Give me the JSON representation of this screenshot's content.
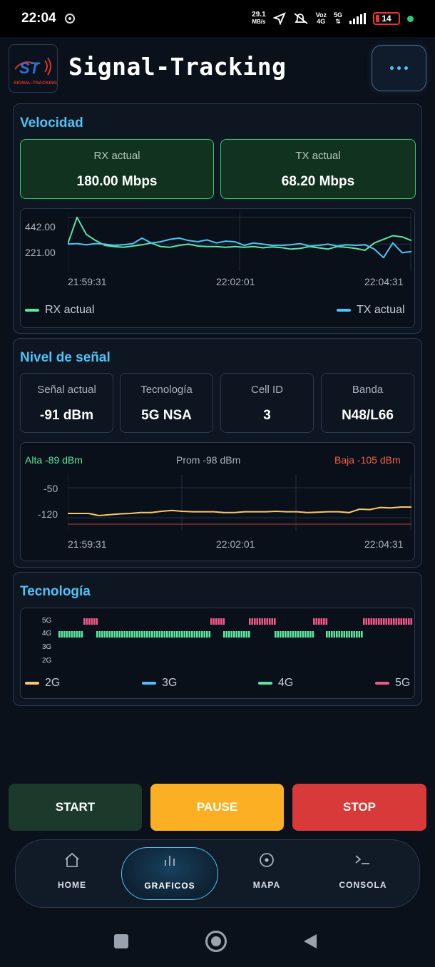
{
  "status_bar": {
    "time": "22:04",
    "net_speed": "29.1",
    "net_unit": "MB/s",
    "volte_top": "Voz",
    "volte_bottom": "4G",
    "network": "5G",
    "battery": "14"
  },
  "header": {
    "title": "Signal-Tracking",
    "logo_text": "ST",
    "logo_caption": "SIGNAL-TRACKING",
    "menu_icon": "more-dots-icon"
  },
  "velocidad": {
    "title": "Velocidad",
    "rx_label": "RX actual",
    "rx_value": "180.00 Mbps",
    "tx_label": "TX actual",
    "tx_value": "68.20 Mbps",
    "chart": {
      "y_ticks": [
        "442.00",
        "221.00"
      ],
      "x_ticks": [
        "21:59:31",
        "22:02:01",
        "22:04:31"
      ],
      "legend_rx": "RX actual",
      "legend_tx": "TX actual",
      "rx_color": "#59e8a0",
      "tx_color": "#4fc3f7"
    }
  },
  "nivel": {
    "title": "Nivel de señal",
    "cards": [
      {
        "label": "Señal actual",
        "value": "-91 dBm"
      },
      {
        "label": "Tecnología",
        "value": "5G NSA"
      },
      {
        "label": "Cell ID",
        "value": "3"
      },
      {
        "label": "Banda",
        "value": "N48/L66"
      }
    ],
    "chart": {
      "alta": "Alta -89 dBm",
      "prom": "Prom -98 dBm",
      "baja": "Baja -105 dBm",
      "y_ticks": [
        "-50",
        "-120"
      ],
      "x_ticks": [
        "21:59:31",
        "22:02:01",
        "22:04:31"
      ],
      "line_color": "#f7c86a"
    }
  },
  "tecnologia": {
    "title": "Tecnología",
    "rows": [
      "5G",
      "4G",
      "3G",
      "2G"
    ],
    "legend": [
      {
        "label": "2G",
        "color": "#f7c86a"
      },
      {
        "label": "3G",
        "color": "#4fc3f7"
      },
      {
        "label": "4G",
        "color": "#59e8a0"
      },
      {
        "label": "5G",
        "color": "#f0588a"
      }
    ]
  },
  "controls": {
    "start": "START",
    "pause": "PAUSE",
    "stop": "STOP"
  },
  "nav": {
    "home": "HOME",
    "graficos": "GRAFICOS",
    "mapa": "MAPA",
    "consola": "CONSOLA"
  },
  "chart_data": [
    {
      "type": "line",
      "x_ticks": [
        "21:59:31",
        "22:02:01",
        "22:04:31"
      ],
      "y_ticks": [
        442.0,
        221.0
      ],
      "ylim": [
        0,
        480
      ],
      "series": [
        {
          "name": "RX actual",
          "values": [
            221,
            440,
            300,
            250,
            210,
            200,
            195,
            205,
            215,
            230,
            200,
            195,
            210,
            220,
            205,
            200,
            200,
            195,
            200,
            195,
            200,
            190,
            198,
            192,
            180,
            185,
            200,
            190,
            180,
            200,
            195,
            185,
            170,
            230,
            260,
            290,
            280,
            250
          ]
        },
        {
          "name": "TX actual",
          "values": [
            221,
            225,
            215,
            225,
            220,
            210,
            215,
            225,
            270,
            230,
            240,
            260,
            270,
            250,
            240,
            255,
            230,
            245,
            240,
            210,
            230,
            220,
            210,
            210,
            215,
            225,
            205,
            210,
            220,
            205,
            215,
            210,
            215,
            180,
            110,
            230,
            150,
            160
          ]
        }
      ]
    },
    {
      "type": "line",
      "x_ticks": [
        "21:59:31",
        "22:02:01",
        "22:04:31"
      ],
      "y_ticks": [
        -50,
        -120
      ],
      "ylim": [
        -150,
        -20
      ],
      "series": [
        {
          "name": "Señal",
          "values": [
            -110,
            -110,
            -110,
            -115,
            -113,
            -111,
            -110,
            -108,
            -108,
            -105,
            -103,
            -105,
            -106,
            -106,
            -106,
            -108,
            -108,
            -106,
            -106,
            -106,
            -105,
            -106,
            -106,
            -108,
            -107,
            -106,
            -106,
            -108,
            -100,
            -101,
            -96,
            -97,
            -95,
            -95
          ]
        }
      ]
    }
  ]
}
